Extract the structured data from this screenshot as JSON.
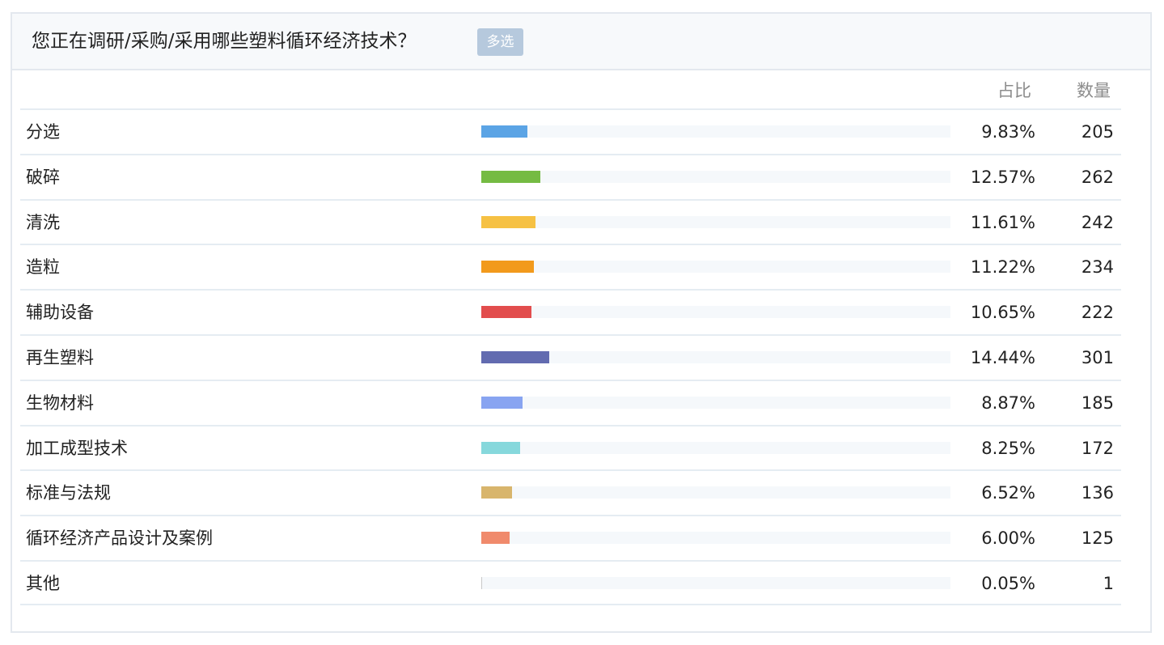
{
  "question": {
    "title": "您正在调研/采购/采用哪些塑料循环经济技术？",
    "badge": "多选"
  },
  "columns": {
    "percent_header": "占比",
    "count_header": "数量"
  },
  "chart_data": {
    "type": "bar",
    "orientation": "horizontal",
    "categories": [
      "分选",
      "破碎",
      "清洗",
      "造粒",
      "辅助设备",
      "再生塑料",
      "生物材料",
      "加工成型技术",
      "标准与法规",
      "循环经济产品设计及案例",
      "其他"
    ],
    "percent_labels": [
      "9.83%",
      "12.57%",
      "11.61%",
      "11.22%",
      "10.65%",
      "14.44%",
      "8.87%",
      "8.25%",
      "6.52%",
      "6.00%",
      "0.05%"
    ],
    "percent_values": [
      9.83,
      12.57,
      11.61,
      11.22,
      10.65,
      14.44,
      8.87,
      8.25,
      6.52,
      6.0,
      0.05
    ],
    "counts": [
      205,
      262,
      242,
      234,
      222,
      301,
      185,
      172,
      136,
      125,
      1
    ],
    "xlim": [
      0,
      100
    ],
    "bar_colors": [
      "#5ba4e5",
      "#75bb43",
      "#f6c143",
      "#f29a1c",
      "#e24d4d",
      "#626bb0",
      "#88a4f1",
      "#86d8dc",
      "#d8b56c",
      "#f08a6c",
      "#c9c9c9"
    ],
    "track_color": "#f5f8fb",
    "grid": false,
    "legend": "none"
  }
}
